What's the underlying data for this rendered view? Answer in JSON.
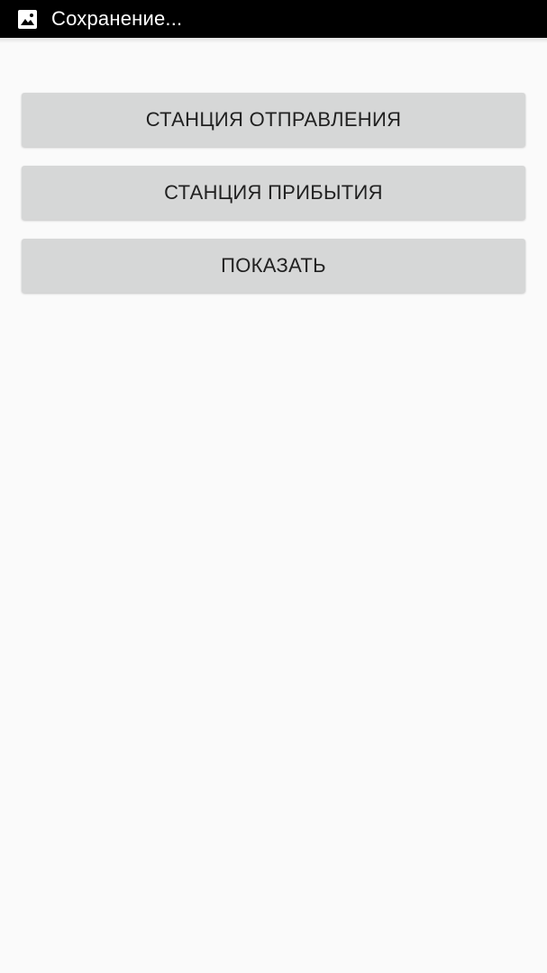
{
  "status_bar": {
    "icon": "image-icon",
    "text": "Сохранение..."
  },
  "buttons": {
    "departure_label": "СТАНЦИЯ ОТПРАВЛЕНИЯ",
    "arrival_label": "СТАНЦИЯ ПРИБЫТИЯ",
    "show_label": "ПОКАЗАТЬ"
  },
  "colors": {
    "status_bar_bg": "#000000",
    "page_bg": "#fafafa",
    "button_bg": "#d6d7d7",
    "button_text": "#212121"
  }
}
